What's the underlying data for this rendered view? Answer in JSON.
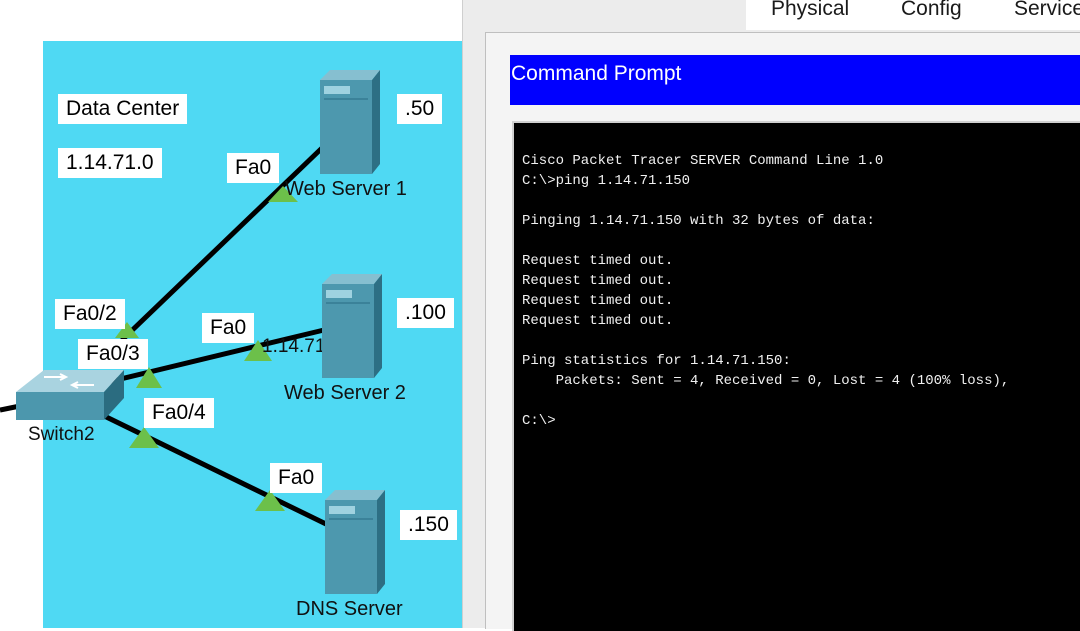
{
  "topology": {
    "area_label": "Data Center",
    "network": "1.14.71.0",
    "devices": {
      "web1": {
        "name": "Web Server 1",
        "ip_suffix": ".50",
        "port": "Fa0"
      },
      "web2": {
        "name": "Web Server 2",
        "ip_suffix": ".100",
        "port": "Fa0"
      },
      "dns": {
        "name": "DNS Server",
        "ip_suffix": ".150",
        "port": "Fa0"
      },
      "switch": {
        "name": "Switch2"
      }
    },
    "switch_ports": [
      "Fa0/2",
      "Fa0/3",
      "Fa0/4"
    ],
    "web2_overlap_text": "1.14.71."
  },
  "window": {
    "tabs": [
      "Physical",
      "Config",
      "Services"
    ],
    "title": "Command Prompt",
    "terminal_lines": [
      "Cisco Packet Tracer SERVER Command Line 1.0",
      "C:\\>ping 1.14.71.150",
      "",
      "Pinging 1.14.71.150 with 32 bytes of data:",
      "",
      "Request timed out.",
      "Request timed out.",
      "Request timed out.",
      "Request timed out.",
      "",
      "Ping statistics for 1.14.71.150:",
      "    Packets: Sent = 4, Received = 0, Lost = 4 (100% loss),",
      "",
      "C:\\>"
    ]
  },
  "colors": {
    "area": "#4fd9f3",
    "link": "#000000",
    "link_up": "#6cc04a",
    "title_bar": "#0000ff",
    "terminal_bg": "#000000",
    "terminal_fg": "#f0f0f0"
  }
}
